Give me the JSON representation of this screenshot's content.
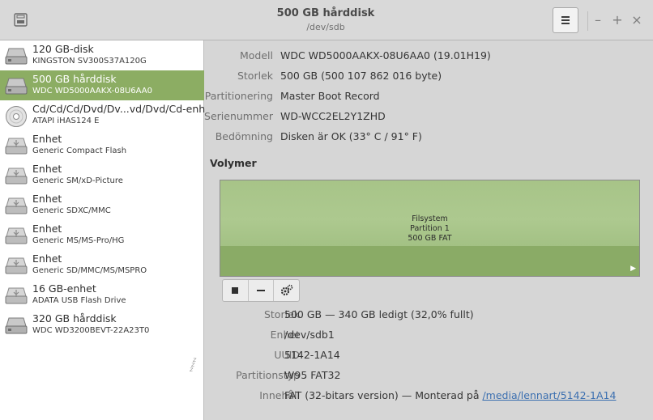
{
  "header": {
    "title": "500 GB hårddisk",
    "subtitle": "/dev/sdb",
    "window_controls": {
      "minimize": "–",
      "maximize": "+",
      "close": "×"
    }
  },
  "drives": [
    {
      "name": "120 GB-disk",
      "model": "KINGSTON SV300S37A120G",
      "icon": "harddisk-icon"
    },
    {
      "name": "500 GB hårddisk",
      "model": "WDC WD5000AAKX-08U6AA0",
      "icon": "harddisk-icon",
      "selected": true
    },
    {
      "name": "Cd/Cd/Cd/Dvd/Dv...vd/Dvd/Cd-enhet",
      "model": "ATAPI   iHAS124   E",
      "icon": "optical-disc-icon"
    },
    {
      "name": "Enhet",
      "model": "Generic Compact Flash",
      "icon": "usb-drive-icon"
    },
    {
      "name": "Enhet",
      "model": "Generic SM/xD-Picture",
      "icon": "usb-drive-icon"
    },
    {
      "name": "Enhet",
      "model": "Generic SDXC/MMC",
      "icon": "usb-drive-icon"
    },
    {
      "name": "Enhet",
      "model": "Generic MS/MS-Pro/HG",
      "icon": "usb-drive-icon"
    },
    {
      "name": "Enhet",
      "model": "Generic SD/MMC/MS/MSPRO",
      "icon": "usb-drive-icon"
    },
    {
      "name": "16 GB-enhet",
      "model": "ADATA USB Flash Drive",
      "icon": "usb-drive-icon"
    },
    {
      "name": "320 GB hårddisk",
      "model": "WDC WD3200BEVT-22A23T0",
      "icon": "harddisk-icon",
      "sleeping": true
    }
  ],
  "sleep_indicator": "zzz",
  "disk_info": {
    "model_label": "Modell",
    "model": "WDC WD5000AAKX-08U6AA0 (19.01H19)",
    "size_label": "Storlek",
    "size": "500 GB (500 107 862 016 byte)",
    "partitioning_label": "Partitionering",
    "partitioning": "Master Boot Record",
    "serial_label": "Serienummer",
    "serial": "WD-WCC2EL2Y1ZHD",
    "assessment_label": "Bedömning",
    "assessment": "Disken är OK (33° C / 91° F)"
  },
  "volumes": {
    "title": "Volymer",
    "block": {
      "line1": "Filsystem",
      "line2": "Partition 1",
      "line3": "500 GB FAT"
    }
  },
  "partition_info": {
    "size_label": "Storlek",
    "size": "500 GB — 340 GB ledigt (32,0% fullt)",
    "device_label": "Enhet",
    "device": "/dev/sdb1",
    "uuid_label": "UUID",
    "uuid": "5142-1A14",
    "type_label": "Partitionstyp",
    "type": "W95 FAT32",
    "contents_label": "Innehåll",
    "contents": "FAT (32-bitars version) — Monterad på ",
    "mount_link": "/media/lennart/5142-1A14"
  },
  "colors": {
    "selection": "#8cad63",
    "volume_fill": "#a7c488",
    "link": "#3b6fb0"
  }
}
